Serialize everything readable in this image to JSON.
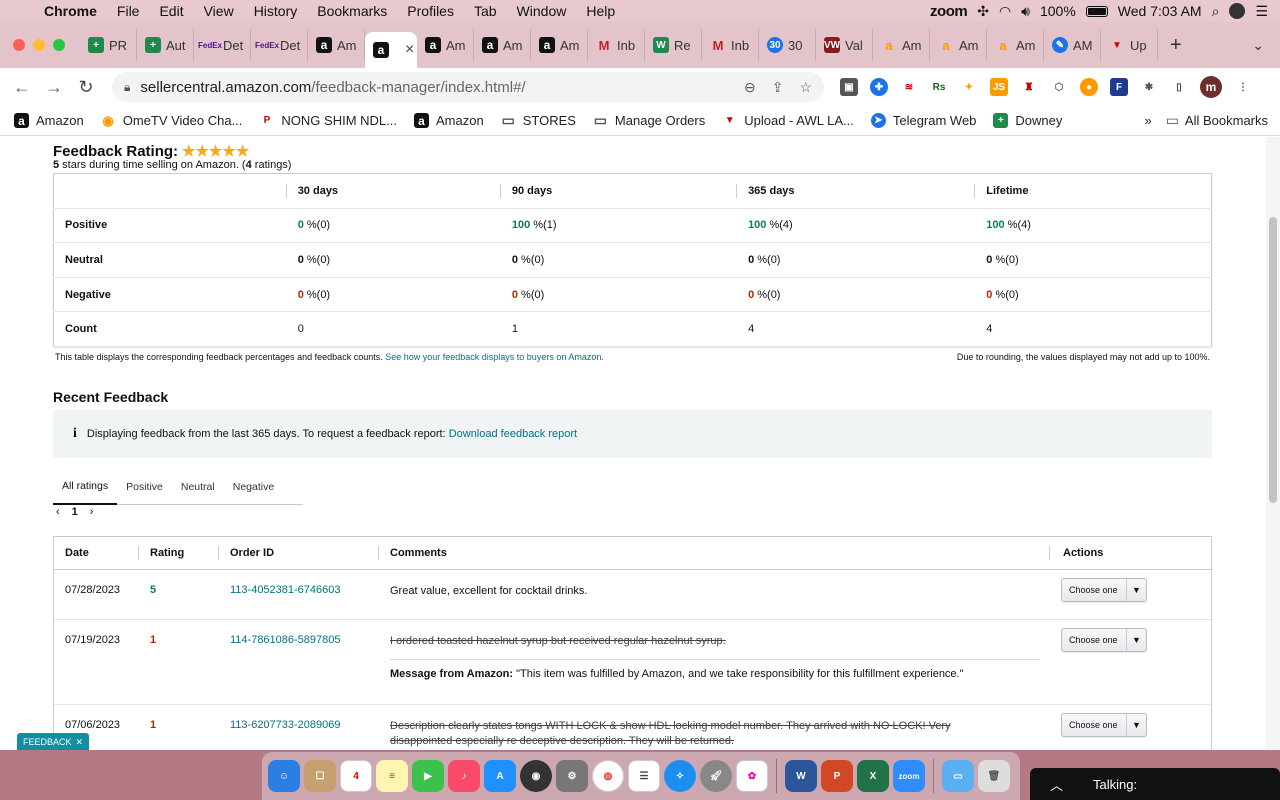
{
  "menubar": {
    "app": "Chrome",
    "items": [
      "File",
      "Edit",
      "View",
      "History",
      "Bookmarks",
      "Profiles",
      "Tab",
      "Window",
      "Help"
    ],
    "zoom_label": "zoom",
    "battery": "100%",
    "clock": "Wed 7:03 AM"
  },
  "tabs": [
    {
      "label": "PR",
      "icon": "green",
      "glyph": "+"
    },
    {
      "label": "Aut",
      "icon": "green",
      "glyph": "+"
    },
    {
      "label": "Det",
      "icon": "fedex",
      "glyph": "FedEx"
    },
    {
      "label": "Det",
      "icon": "fedex",
      "glyph": "FedEx"
    },
    {
      "label": "Am",
      "icon": "amz",
      "glyph": "a"
    },
    {
      "label": "",
      "icon": "amz",
      "glyph": "a",
      "active": true
    },
    {
      "label": "Am",
      "icon": "amz",
      "glyph": "a"
    },
    {
      "label": "Am",
      "icon": "amz",
      "glyph": "a"
    },
    {
      "label": "Am",
      "icon": "amz",
      "glyph": "a"
    },
    {
      "label": "Inb",
      "icon": "gmail",
      "glyph": "M"
    },
    {
      "label": "Re",
      "icon": "green",
      "glyph": "W"
    },
    {
      "label": "Inb",
      "icon": "gmail",
      "glyph": "M"
    },
    {
      "label": "30",
      "icon": "blue",
      "glyph": "30"
    },
    {
      "label": "Val",
      "icon": "vw",
      "glyph": "VW"
    },
    {
      "label": "Am",
      "icon": "amzsmile",
      "glyph": "a"
    },
    {
      "label": "Am",
      "icon": "amzsmile",
      "glyph": "a"
    },
    {
      "label": "Am",
      "icon": "amzsmile",
      "glyph": "a"
    },
    {
      "label": "AM",
      "icon": "blue",
      "glyph": "✎"
    },
    {
      "label": "Up",
      "icon": "red",
      "glyph": "▼"
    }
  ],
  "address": {
    "host": "sellercentral.amazon.com",
    "path": "/feedback-manager/index.html#/"
  },
  "bookmarks": [
    {
      "label": "Amazon",
      "icon": "amz",
      "glyph": "a"
    },
    {
      "label": "OmeTV Video Cha...",
      "icon": "amzsmile",
      "glyph": "◉"
    },
    {
      "label": "NONG SHIM NDL...",
      "icon": "red",
      "glyph": "P"
    },
    {
      "label": "Amazon",
      "icon": "amz",
      "glyph": "a"
    },
    {
      "label": "STORES",
      "icon": "folder",
      "glyph": "▭"
    },
    {
      "label": "Manage Orders",
      "icon": "folder",
      "glyph": "▭"
    },
    {
      "label": "Upload - AWL LA...",
      "icon": "red",
      "glyph": "▼"
    },
    {
      "label": "Telegram Web",
      "icon": "blue",
      "glyph": "➤"
    },
    {
      "label": "Downey",
      "icon": "green",
      "glyph": "+"
    }
  ],
  "all_bookmarks": "All Bookmarks",
  "feedback_rating": {
    "title": "Feedback Rating:",
    "stars": "★★★★★",
    "sub_stars": "5",
    "sub_text": " stars during time selling on Amazon. (",
    "sub_count": "4",
    "sub_end": " ratings)",
    "columns": [
      "30 days",
      "90 days",
      "365 days",
      "Lifetime"
    ],
    "rows": [
      {
        "label": "Positive",
        "kind": "pos",
        "cells": [
          {
            "pct": "0",
            "n": " %(0)"
          },
          {
            "pct": "100",
            "n": " %(1)"
          },
          {
            "pct": "100",
            "n": " %(4)"
          },
          {
            "pct": "100",
            "n": " %(4)"
          }
        ]
      },
      {
        "label": "Neutral",
        "kind": "neu",
        "cells": [
          {
            "pct": "0",
            "n": " %(0)"
          },
          {
            "pct": "0",
            "n": " %(0)"
          },
          {
            "pct": "0",
            "n": " %(0)"
          },
          {
            "pct": "0",
            "n": " %(0)"
          }
        ]
      },
      {
        "label": "Negative",
        "kind": "neg",
        "cells": [
          {
            "pct": "0",
            "n": " %(0)"
          },
          {
            "pct": "0",
            "n": " %(0)"
          },
          {
            "pct": "0",
            "n": " %(0)"
          },
          {
            "pct": "0",
            "n": " %(0)"
          }
        ]
      },
      {
        "label": "Count",
        "kind": "count",
        "cells": [
          {
            "pct": "",
            "n": "0"
          },
          {
            "pct": "",
            "n": "1"
          },
          {
            "pct": "",
            "n": "4"
          },
          {
            "pct": "",
            "n": "4"
          }
        ]
      }
    ],
    "note": "This table displays the corresponding feedback percentages and feedback counts. ",
    "note_link": "See how your feedback displays to buyers on Amazon.",
    "note_right": "Due to rounding, the values displayed may not add up to 100%."
  },
  "recent": {
    "title": "Recent Feedback",
    "info_text": "Displaying feedback from the last 365 days. To request a feedback report: ",
    "info_link": "Download feedback report",
    "filters": [
      "All ratings",
      "Positive",
      "Neutral",
      "Negative"
    ],
    "page": "1",
    "columns": [
      "Date",
      "Rating",
      "Order ID",
      "Comments",
      "Actions"
    ],
    "action_label": "Choose one",
    "rows": [
      {
        "date": "07/28/2023",
        "rating": "5",
        "kind": "pos",
        "order": "113-4052381-6746603",
        "comment": "Great value, excellent for cocktail drinks.",
        "struck": false
      },
      {
        "date": "07/19/2023",
        "rating": "1",
        "kind": "neg",
        "order": "114-7861086-5897805",
        "comment": "I ordered toasted hazelnut syrup but received regular hazelnut syrup.",
        "struck": true,
        "amazon_label": "Message from Amazon:",
        "amazon_msg": " \"This item was fulfilled by Amazon, and we take responsibility for this fulfillment experience.\""
      },
      {
        "date": "07/06/2023",
        "rating": "1",
        "kind": "neg",
        "order": "113-6207733-2089069",
        "comment": "Description clearly states tongs WITH LOCK & show HDL locking model number. They arrived with NO LOCK! Very disappointed especially re deceptive description. They will be returned.",
        "struck": true
      }
    ]
  },
  "feedback_tab": "FEEDBACK",
  "dock_talking": "Talking:",
  "dock_date": "4",
  "colors": {
    "positive": "#067d62",
    "negative": "#b12704",
    "link": "#007185",
    "feedback_tab": "#108fa2"
  }
}
